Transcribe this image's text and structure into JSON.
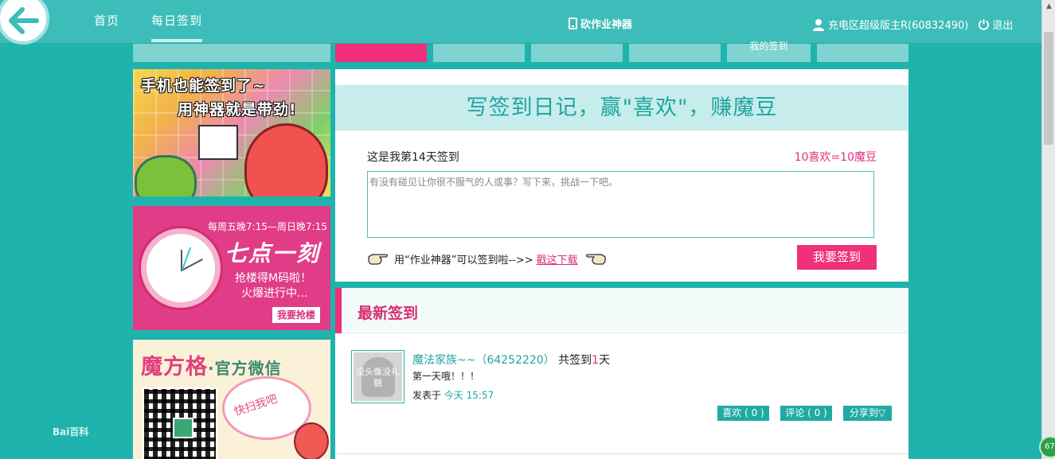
{
  "topbar": {
    "nav": [
      {
        "label": "首页"
      },
      {
        "label": "每日签到"
      }
    ],
    "app_title": "砍作业神器",
    "user": "充电区超级版主R(60832490)",
    "logout": "退出"
  },
  "tabs": [
    {
      "label": "",
      "active": true
    },
    {
      "label": "",
      "active": false
    },
    {
      "label": "",
      "active": false
    },
    {
      "label": "",
      "active": false
    },
    {
      "label": "我的签到",
      "active": false
    },
    {
      "label": "",
      "active": false
    }
  ],
  "banners": {
    "mobile": {
      "line1": "手机也能签到了~",
      "line2": "用神器就是带劲!"
    },
    "grab": {
      "time_range": "每周五晚7:15—周日晚7:15",
      "title": "七点一刻",
      "sub1": "抢楼得M码啦！",
      "sub2": "火爆进行中...",
      "button": "我要抢楼"
    },
    "wechat": {
      "title_main": "魔方格",
      "title_sub": "·官方微信",
      "scan": "快扫我吧"
    },
    "baidu_logo": "Bai百科"
  },
  "signin": {
    "headline": "写签到日记，赢\"喜欢\"，赚魔豆",
    "count_text": "这是我第14天签到",
    "reward_text": "10喜欢=10魔豆",
    "placeholder": "有没有碰见让你很不服气的人或事？写下来，挑战一下吧。",
    "hint_text": "用“作业神器”可以签到啦-->>",
    "download_link": "戳这下载",
    "submit_label": "我要签到"
  },
  "latest": {
    "title": "最新签到",
    "items": [
      {
        "avatar_text": "没头像没礼貌",
        "user_name": "魔法家族~~（64252220）",
        "days_prefix": "共签到",
        "days": "1",
        "days_suffix": "天",
        "content": "第一天哦！！！",
        "posted_prefix": "发表于",
        "posted_time": "今天 15:57",
        "like_label": "喜欢 ( 0 )",
        "comment_label": "评论 ( 0 )",
        "share_label": "分享到▽"
      }
    ]
  },
  "scroll_badge": "67"
}
